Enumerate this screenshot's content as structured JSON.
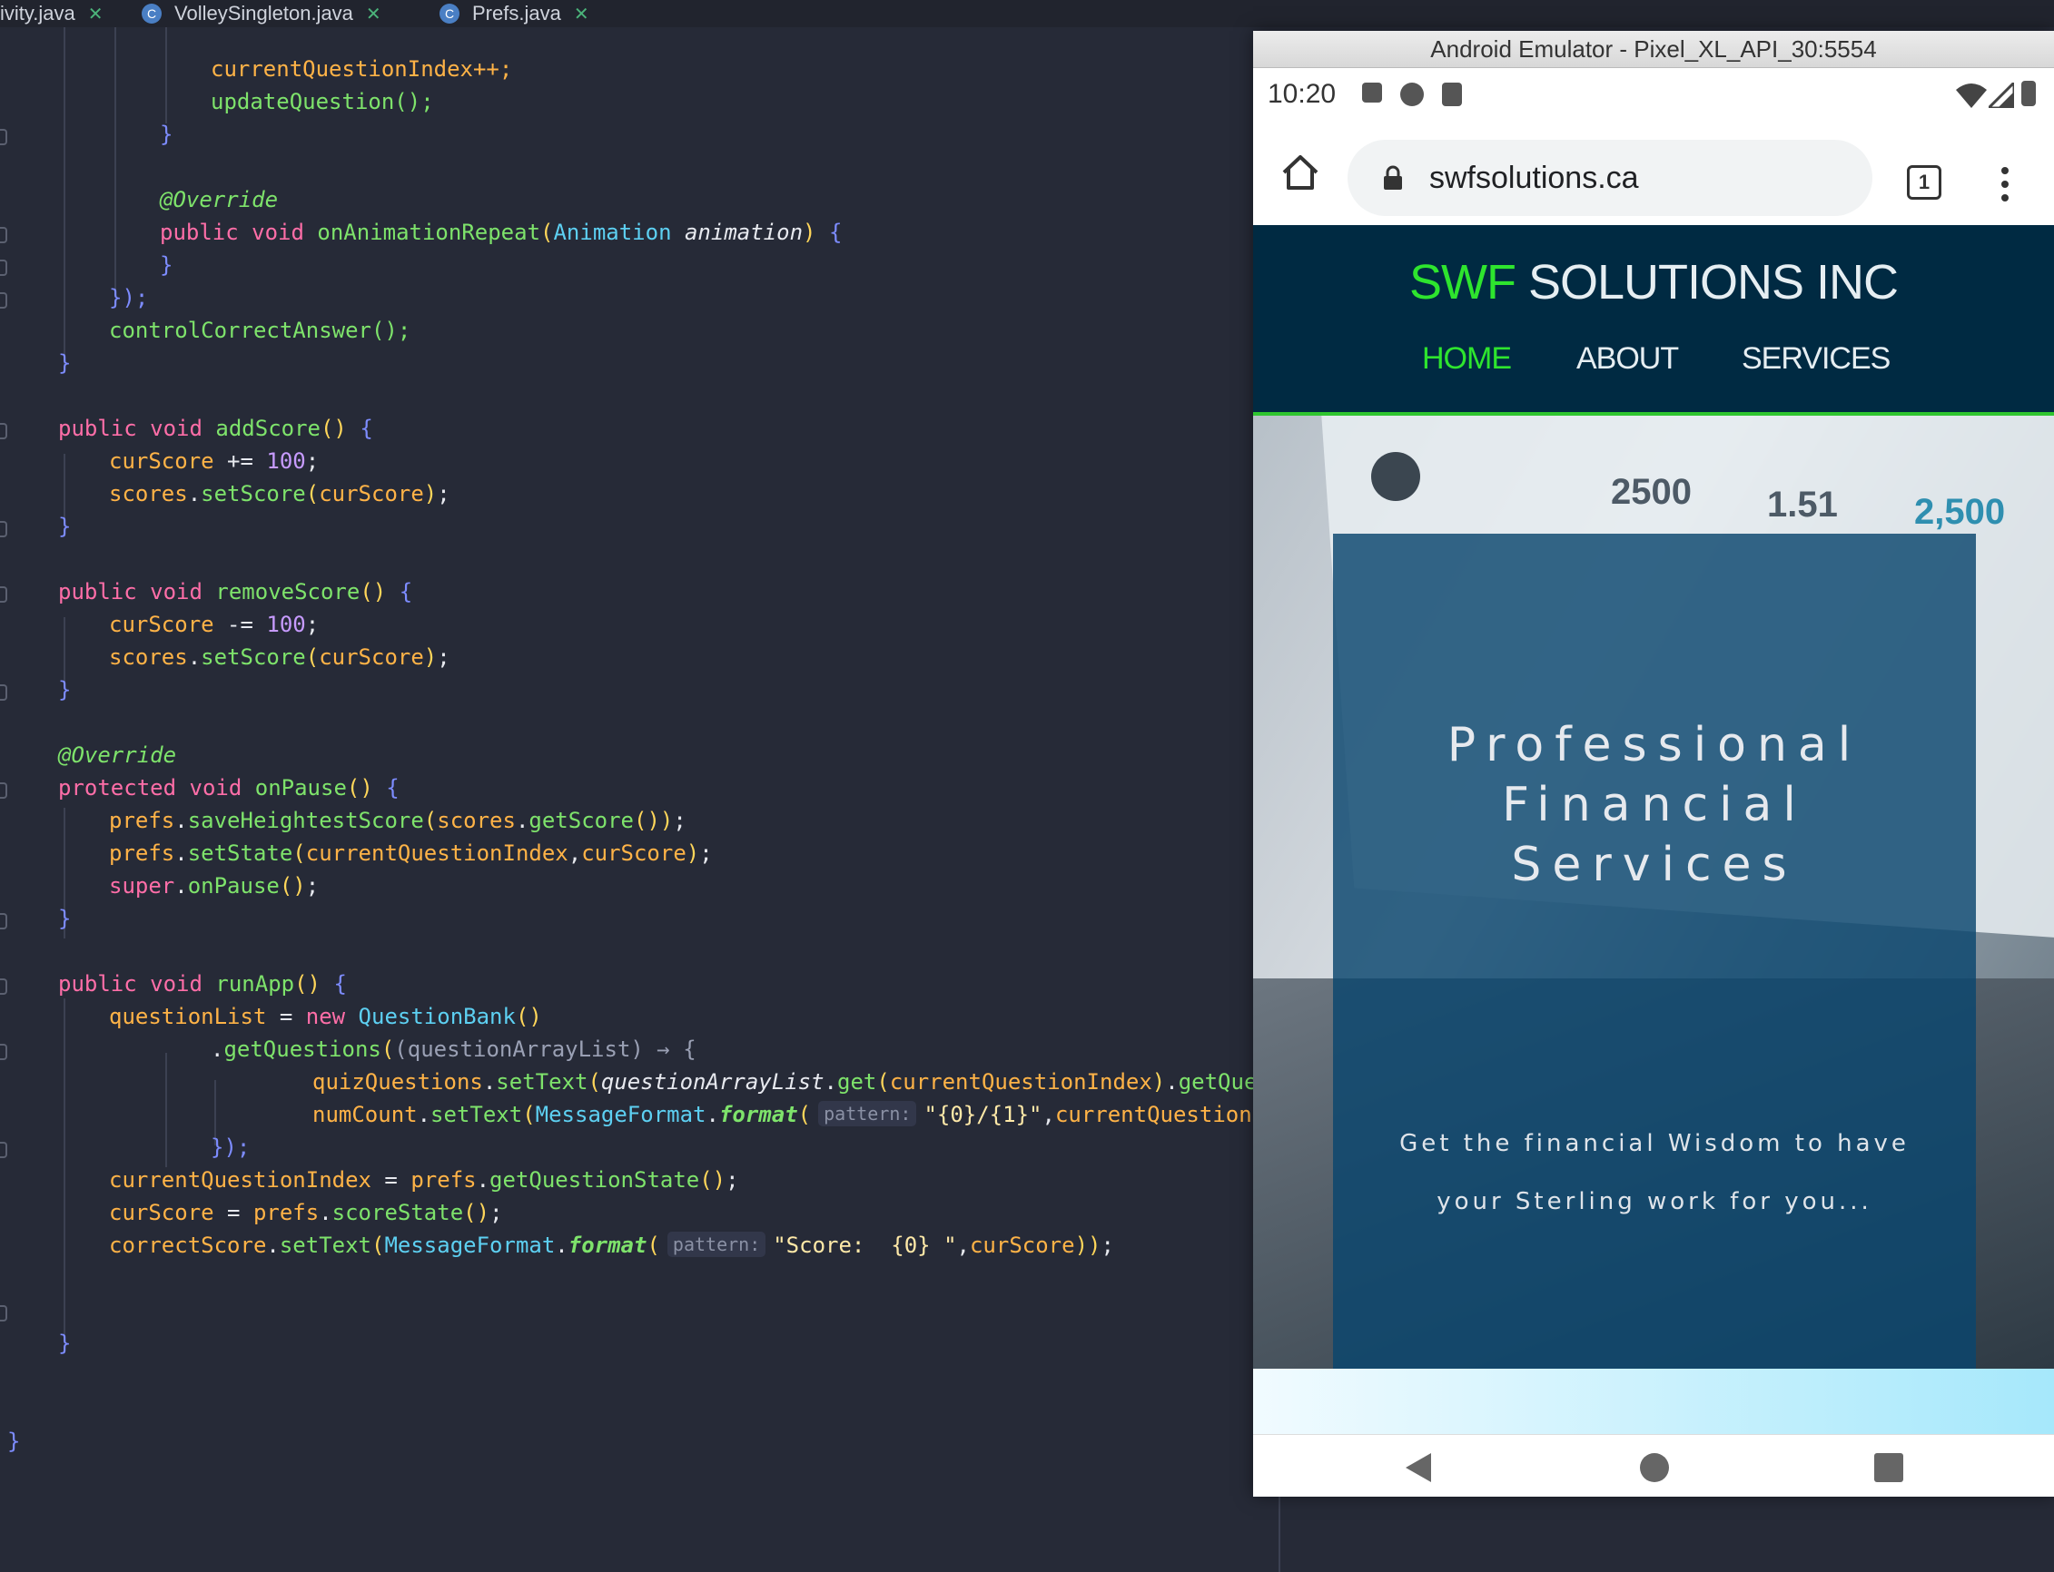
{
  "tabs": [
    {
      "label": "ivity.java"
    },
    {
      "label": "VolleySingleton.java",
      "icon": "C"
    },
    {
      "label": "Prefs.java",
      "icon": "C"
    }
  ],
  "code": {
    "l1": "currentQuestionIndex++;",
    "l2": "updateQuestion();",
    "l4": "@Override",
    "l5a": "public void ",
    "l5b": "onAnimationRepeat",
    "l5c": "Animation ",
    "l5d": "animation",
    "l7": "});",
    "l8": "controlCorrectAnswer();",
    "add_sig": "addScore",
    "add1a": "curScore",
    "add1b": " += ",
    "add1c": "100",
    "add2a": "scores",
    "add2b": "setScore",
    "add2c": "curScore",
    "rem_sig": "removeScore",
    "rem1b": " -= ",
    "pause_ann": "@Override",
    "pause_sig_kw": "protected void ",
    "pause_sig": "onPause",
    "p1a": "prefs",
    "p1b": "saveHeightestScore",
    "p1c": "scores",
    "p1d": "getScore",
    "p2b": "setState",
    "p2c": "currentQuestionIndex",
    "p2d": "curScore",
    "p3a": "super",
    "p3b": "onPause",
    "run_sig": "runApp",
    "r1a": "questionList",
    "r1b": " = ",
    "r1c": "new ",
    "r1d": "QuestionBank",
    "r2a": "getQuestions",
    "r2b": "questionArrayList",
    "r3a": "quizQuestions",
    "r3b": "setText",
    "r3c": "questionArrayList",
    "r3d": "get",
    "r3e": "currentQuestionIndex",
    "r3f": "getQuest",
    "r4a": "numCount",
    "r4b": "setText",
    "r4c": "MessageFormat",
    "r4d": "format",
    "r4hint": "pattern:",
    "r4e": "\"{0}/{1}\"",
    "r4f": "currentQuestionInc",
    "r5": "});",
    "r6a": "currentQuestionIndex",
    "r6b": "prefs",
    "r6c": "getQuestionState",
    "r7a": "curScore",
    "r7b": "prefs",
    "r7c": "scoreState",
    "r8a": "correctScore",
    "r8b": "setText",
    "r8c": "MessageFormat",
    "r8d": "format",
    "r8hint": "pattern:",
    "r8e": "\"Score:  {0} \"",
    "r8f": "curScore",
    "pub_void": "public void ",
    "brace_close": "}",
    "brace_open": "{"
  },
  "emulator": {
    "title": "Android Emulator - Pixel_XL_API_30:5554",
    "time": "10:20",
    "url": "swfsolutions.ca",
    "tab_count": "1",
    "brand_green": "SWF",
    "brand_white": " SOLUTIONS INC",
    "nav": {
      "home": "HOME",
      "about": "ABOUT",
      "services": "SERVICES"
    },
    "stats": {
      "a": "2500",
      "b": "1.51",
      "c": "2,500"
    },
    "hero_title": [
      "Professional",
      "Financial",
      "Services"
    ],
    "hero_sub": [
      "Get the financial Wisdom to have",
      "your Sterling work for you..."
    ],
    "colors": {
      "header_bg": "#002a42",
      "accent_green": "#2ee52e",
      "overlay": "#0a466e"
    }
  }
}
